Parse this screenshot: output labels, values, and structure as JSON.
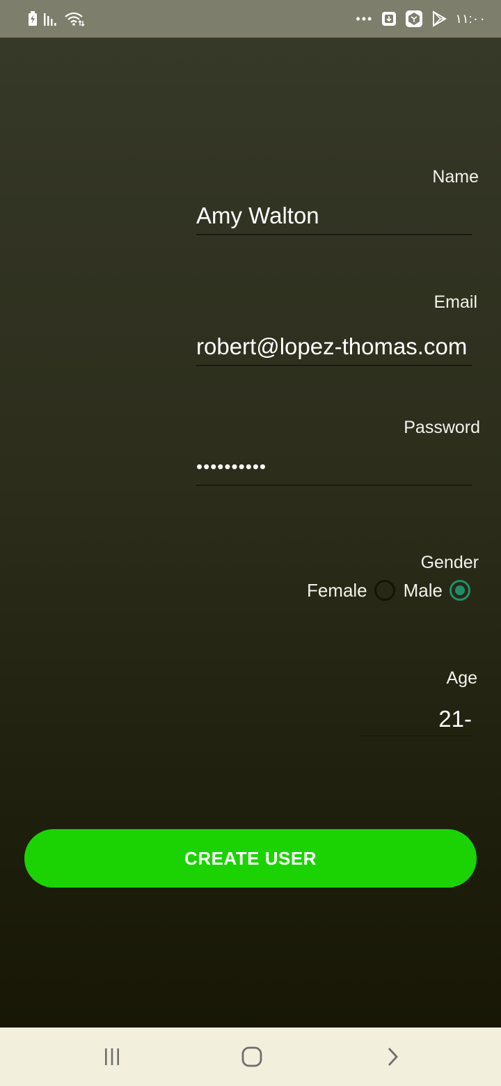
{
  "status_bar": {
    "time": "١١:٠٠",
    "overflow_dots": "•••",
    "left_icons": [
      "battery-charging-icon",
      "signal-icon",
      "wifi-icon"
    ],
    "right_icons": [
      "download-icon",
      "app-icon",
      "play-store-icon"
    ]
  },
  "form": {
    "name": {
      "label": "Name",
      "value": "Amy Walton"
    },
    "email": {
      "label": "Email",
      "value": "robert@lopez-thomas.com"
    },
    "password": {
      "label": "Password",
      "value": "••••••••••"
    },
    "gender": {
      "label": "Gender",
      "options": [
        {
          "label": "Female",
          "checked": false
        },
        {
          "label": "Male",
          "checked": true
        }
      ]
    },
    "age": {
      "label": "Age",
      "value": "21-"
    },
    "submit_label": "CREATE USER"
  },
  "colors": {
    "accent": "#1BD303",
    "radio_checked": "#1F8F6A",
    "status_bar": "#7E7E6C",
    "nav_bar": "#F2EFDD"
  },
  "nav_bar": {
    "buttons": [
      "recents-icon",
      "home-icon",
      "back-icon"
    ]
  }
}
